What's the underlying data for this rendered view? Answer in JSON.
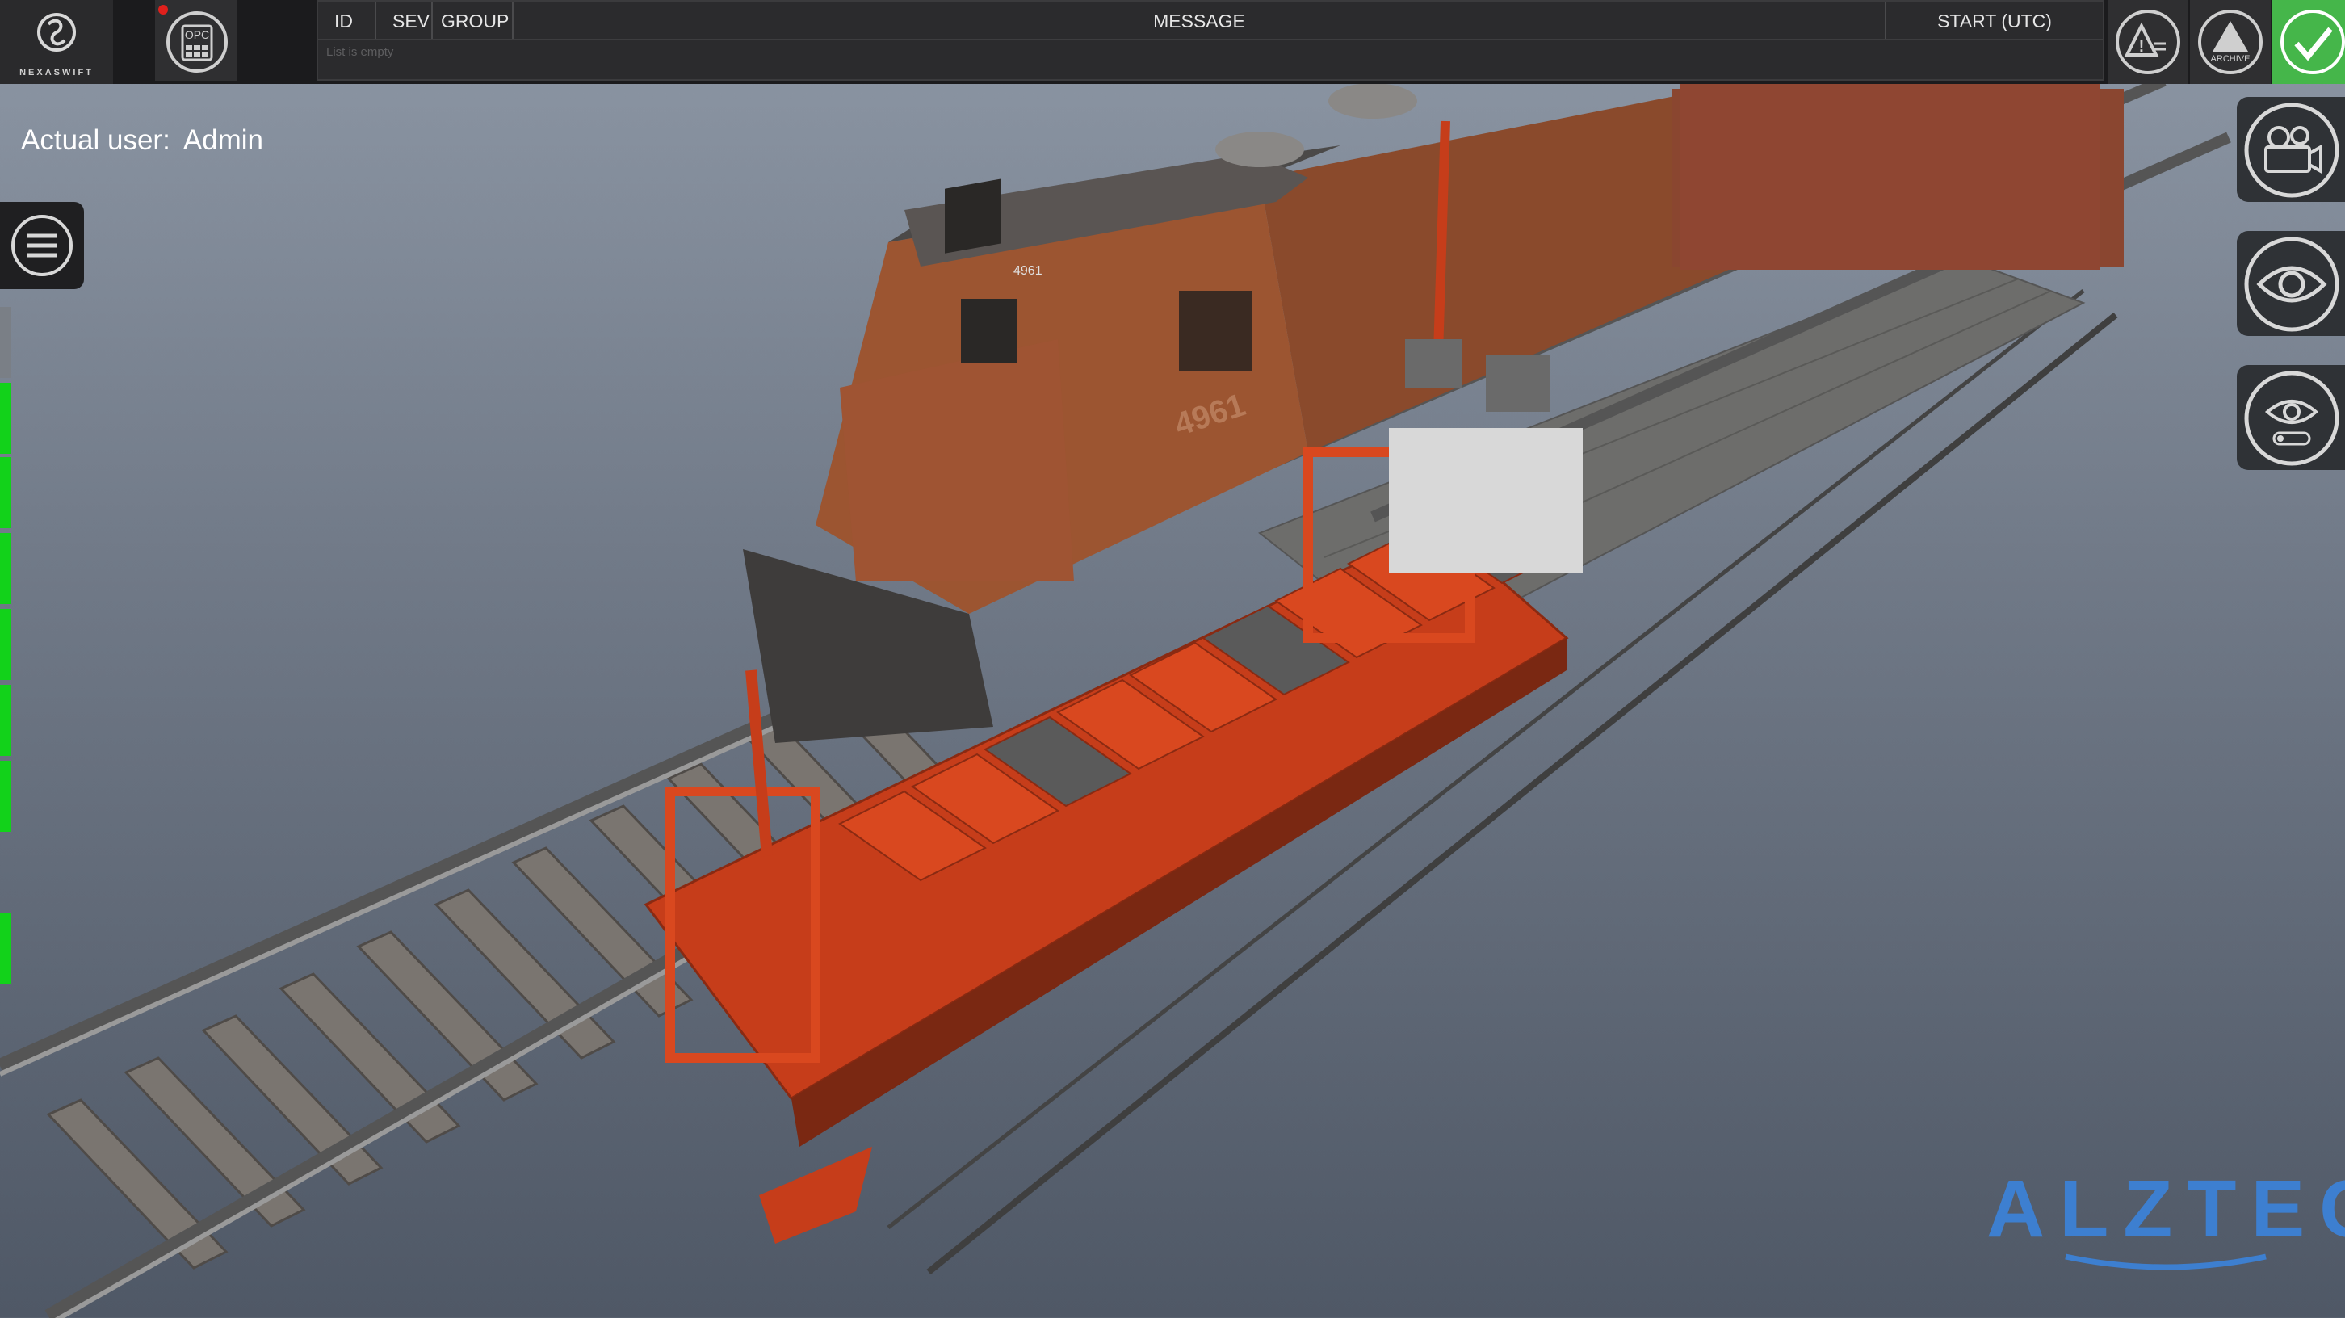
{
  "logo": {
    "text": "NEXASWIFT",
    "icon": "nexaswift-logo"
  },
  "opc": {
    "label": "OPC",
    "icon": "opc-server-icon",
    "status_color": "#e0201c"
  },
  "alarm_table": {
    "columns": [
      "ID",
      "SEV",
      "GROUP",
      "MESSAGE",
      "START (UTC)"
    ],
    "empty_text": "List is empty"
  },
  "top_buttons": [
    {
      "icon": "alarm-list-icon",
      "label": ""
    },
    {
      "icon": "archive-icon",
      "label": "ARCHIVE"
    },
    {
      "icon": "acknowledge-check-icon",
      "label": "",
      "color": "#45b64a"
    }
  ],
  "user": {
    "label": "Actual user:",
    "name": "Admin"
  },
  "status_indicators": [
    {
      "color": "#7a7f86"
    },
    {
      "color": "#12d21a"
    },
    {
      "color": "#12d21a"
    },
    {
      "color": "#12d21a"
    },
    {
      "color": "#12d21a"
    },
    {
      "color": "#12d21a"
    },
    {
      "color": "#12d21a"
    },
    {
      "color": "#12d21a"
    }
  ],
  "side_tools": [
    {
      "icon": "camera-views-icon"
    },
    {
      "icon": "eye-icon"
    },
    {
      "icon": "eye-toggle-icon"
    }
  ],
  "scene": {
    "locomotive_number": "4961",
    "roof_number": "4961"
  },
  "brand": {
    "text": "ALZTEC",
    "color": "#3d7fd0"
  }
}
